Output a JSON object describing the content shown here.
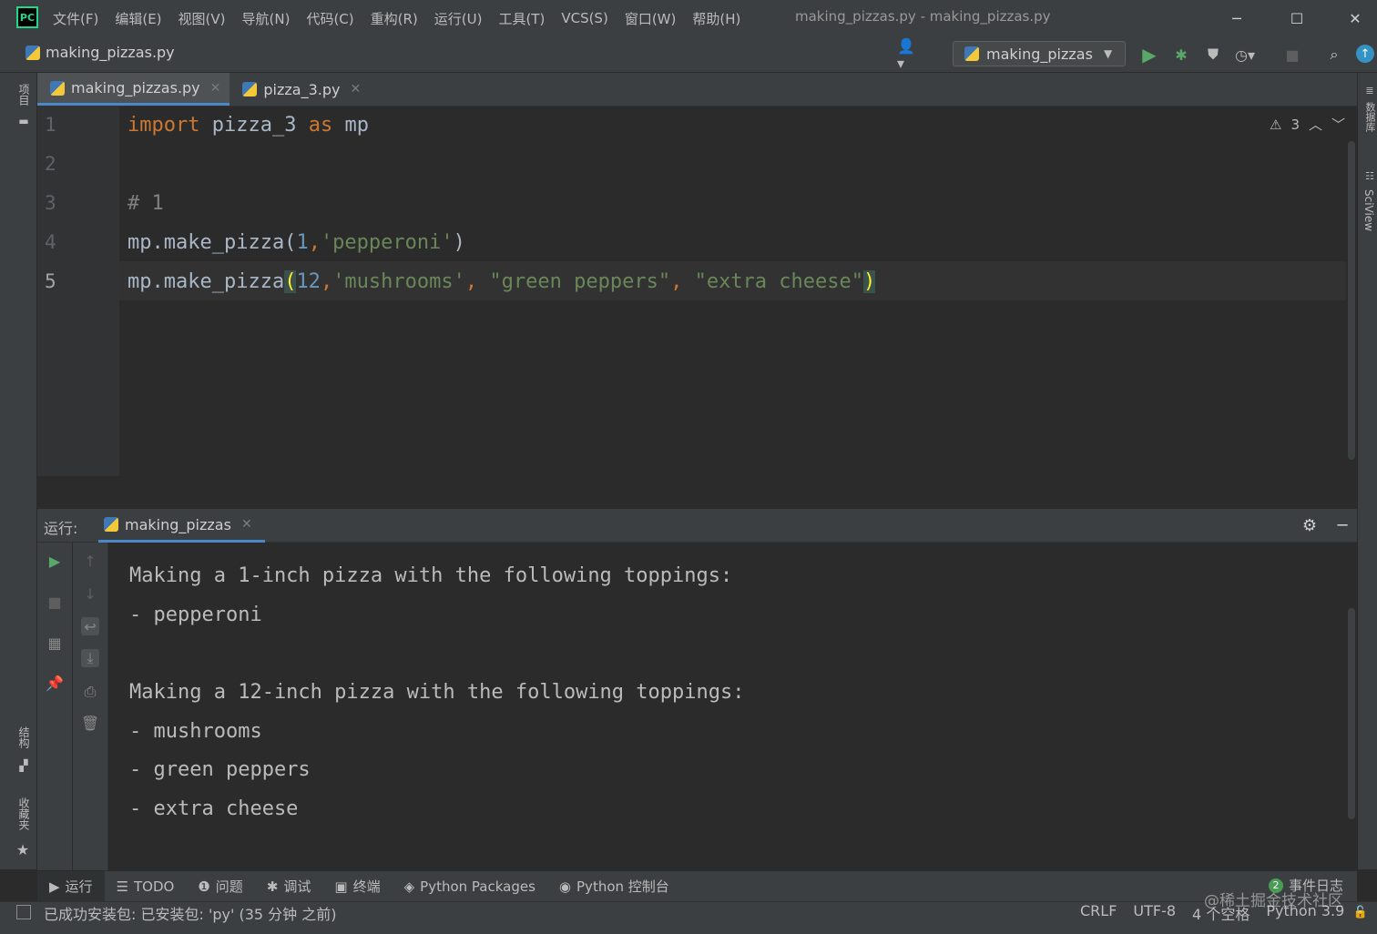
{
  "app": {
    "logo_text": "PC",
    "window_title": "making_pizzas.py - making_pizzas.py",
    "menu": [
      "文件(F)",
      "编辑(E)",
      "视图(V)",
      "导航(N)",
      "代码(C)",
      "重构(R)",
      "运行(U)",
      "工具(T)",
      "VCS(S)",
      "窗口(W)",
      "帮助(H)"
    ]
  },
  "toolbar": {
    "breadcrumb": "making_pizzas.py",
    "run_config": "making_pizzas"
  },
  "left_stripe": {
    "project_label": "项目",
    "structure_label": "结构",
    "favorites_label": "收藏夹"
  },
  "right_stripe": {
    "database_label": "数据库",
    "sciview_label": "SciView"
  },
  "tabs": [
    {
      "label": "making_pizzas.py",
      "active": true
    },
    {
      "label": "pizza_3.py",
      "active": false
    }
  ],
  "editor": {
    "line_numbers": [
      "1",
      "2",
      "3",
      "4",
      "5"
    ],
    "current_line": "5",
    "inspection_count": "3",
    "lines": {
      "l1": {
        "kw1": "import",
        "mod": " pizza_3 ",
        "kw2": "as",
        "alias": " mp"
      },
      "l3": {
        "comment": "# 1"
      },
      "l4": {
        "call": "mp.make_pizza(",
        "num": "1",
        "comma": ",",
        "str": "'pepperoni'",
        "close": ")"
      },
      "l5": {
        "call": "mp.make_pizza",
        "open": "(",
        "num": "12",
        "comma1": ",",
        "str1": "'mushrooms'",
        "comma2": ", ",
        "str2": "\"green peppers\"",
        "comma3": ", ",
        "str3": "\"extra cheese\"",
        "close": ")"
      }
    }
  },
  "run_panel": {
    "label": "运行:",
    "tab": "making_pizzas",
    "output": [
      "Making a 1-inch pizza with the following toppings:",
      "- pepperoni",
      "",
      "Making a 12-inch pizza with the following toppings:",
      "- mushrooms",
      "- green peppers",
      "- extra cheese"
    ]
  },
  "bottom_tabs": [
    "运行",
    "TODO",
    "问题",
    "调试",
    "终端",
    "Python Packages",
    "Python 控制台"
  ],
  "event_log": {
    "count": "2",
    "label": "事件日志"
  },
  "status": {
    "message": "已成功安装包: 已安装包: 'py' (35 分钟 之前)",
    "line_sep": "CRLF",
    "encoding": "UTF-8",
    "indent": "4 个空格",
    "interpreter": "Python 3.9"
  },
  "watermark": "@稀土掘金技术社区",
  "colors": {
    "keyword": "#cc7832",
    "string": "#6a8759",
    "number": "#6897bb",
    "comment": "#808080",
    "run_green": "#59a869",
    "accent_blue": "#4a88c7"
  }
}
